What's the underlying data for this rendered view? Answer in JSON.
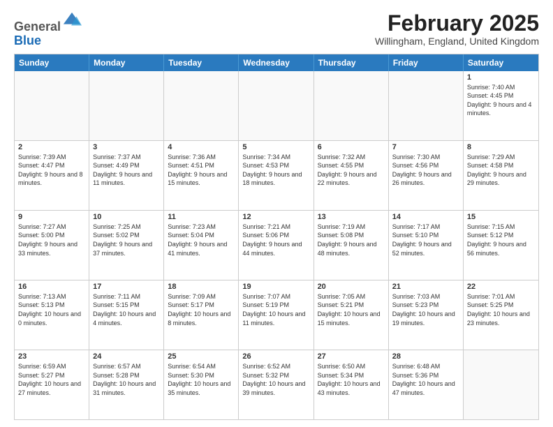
{
  "logo": {
    "general": "General",
    "blue": "Blue"
  },
  "header": {
    "month": "February 2025",
    "location": "Willingham, England, United Kingdom"
  },
  "weekdays": [
    "Sunday",
    "Monday",
    "Tuesday",
    "Wednesday",
    "Thursday",
    "Friday",
    "Saturday"
  ],
  "weeks": [
    [
      {
        "day": "",
        "info": ""
      },
      {
        "day": "",
        "info": ""
      },
      {
        "day": "",
        "info": ""
      },
      {
        "day": "",
        "info": ""
      },
      {
        "day": "",
        "info": ""
      },
      {
        "day": "",
        "info": ""
      },
      {
        "day": "1",
        "info": "Sunrise: 7:40 AM\nSunset: 4:45 PM\nDaylight: 9 hours and 4 minutes."
      }
    ],
    [
      {
        "day": "2",
        "info": "Sunrise: 7:39 AM\nSunset: 4:47 PM\nDaylight: 9 hours and 8 minutes."
      },
      {
        "day": "3",
        "info": "Sunrise: 7:37 AM\nSunset: 4:49 PM\nDaylight: 9 hours and 11 minutes."
      },
      {
        "day": "4",
        "info": "Sunrise: 7:36 AM\nSunset: 4:51 PM\nDaylight: 9 hours and 15 minutes."
      },
      {
        "day": "5",
        "info": "Sunrise: 7:34 AM\nSunset: 4:53 PM\nDaylight: 9 hours and 18 minutes."
      },
      {
        "day": "6",
        "info": "Sunrise: 7:32 AM\nSunset: 4:55 PM\nDaylight: 9 hours and 22 minutes."
      },
      {
        "day": "7",
        "info": "Sunrise: 7:30 AM\nSunset: 4:56 PM\nDaylight: 9 hours and 26 minutes."
      },
      {
        "day": "8",
        "info": "Sunrise: 7:29 AM\nSunset: 4:58 PM\nDaylight: 9 hours and 29 minutes."
      }
    ],
    [
      {
        "day": "9",
        "info": "Sunrise: 7:27 AM\nSunset: 5:00 PM\nDaylight: 9 hours and 33 minutes."
      },
      {
        "day": "10",
        "info": "Sunrise: 7:25 AM\nSunset: 5:02 PM\nDaylight: 9 hours and 37 minutes."
      },
      {
        "day": "11",
        "info": "Sunrise: 7:23 AM\nSunset: 5:04 PM\nDaylight: 9 hours and 41 minutes."
      },
      {
        "day": "12",
        "info": "Sunrise: 7:21 AM\nSunset: 5:06 PM\nDaylight: 9 hours and 44 minutes."
      },
      {
        "day": "13",
        "info": "Sunrise: 7:19 AM\nSunset: 5:08 PM\nDaylight: 9 hours and 48 minutes."
      },
      {
        "day": "14",
        "info": "Sunrise: 7:17 AM\nSunset: 5:10 PM\nDaylight: 9 hours and 52 minutes."
      },
      {
        "day": "15",
        "info": "Sunrise: 7:15 AM\nSunset: 5:12 PM\nDaylight: 9 hours and 56 minutes."
      }
    ],
    [
      {
        "day": "16",
        "info": "Sunrise: 7:13 AM\nSunset: 5:13 PM\nDaylight: 10 hours and 0 minutes."
      },
      {
        "day": "17",
        "info": "Sunrise: 7:11 AM\nSunset: 5:15 PM\nDaylight: 10 hours and 4 minutes."
      },
      {
        "day": "18",
        "info": "Sunrise: 7:09 AM\nSunset: 5:17 PM\nDaylight: 10 hours and 8 minutes."
      },
      {
        "day": "19",
        "info": "Sunrise: 7:07 AM\nSunset: 5:19 PM\nDaylight: 10 hours and 11 minutes."
      },
      {
        "day": "20",
        "info": "Sunrise: 7:05 AM\nSunset: 5:21 PM\nDaylight: 10 hours and 15 minutes."
      },
      {
        "day": "21",
        "info": "Sunrise: 7:03 AM\nSunset: 5:23 PM\nDaylight: 10 hours and 19 minutes."
      },
      {
        "day": "22",
        "info": "Sunrise: 7:01 AM\nSunset: 5:25 PM\nDaylight: 10 hours and 23 minutes."
      }
    ],
    [
      {
        "day": "23",
        "info": "Sunrise: 6:59 AM\nSunset: 5:27 PM\nDaylight: 10 hours and 27 minutes."
      },
      {
        "day": "24",
        "info": "Sunrise: 6:57 AM\nSunset: 5:28 PM\nDaylight: 10 hours and 31 minutes."
      },
      {
        "day": "25",
        "info": "Sunrise: 6:54 AM\nSunset: 5:30 PM\nDaylight: 10 hours and 35 minutes."
      },
      {
        "day": "26",
        "info": "Sunrise: 6:52 AM\nSunset: 5:32 PM\nDaylight: 10 hours and 39 minutes."
      },
      {
        "day": "27",
        "info": "Sunrise: 6:50 AM\nSunset: 5:34 PM\nDaylight: 10 hours and 43 minutes."
      },
      {
        "day": "28",
        "info": "Sunrise: 6:48 AM\nSunset: 5:36 PM\nDaylight: 10 hours and 47 minutes."
      },
      {
        "day": "",
        "info": ""
      }
    ]
  ]
}
